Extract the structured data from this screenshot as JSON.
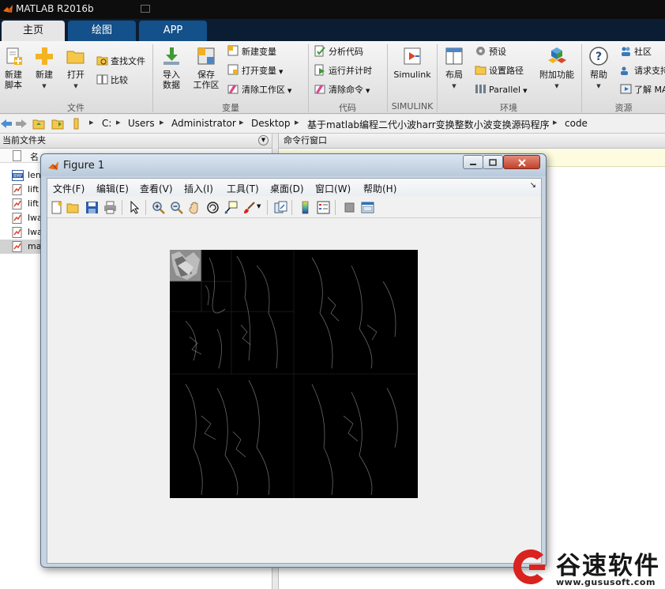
{
  "window": {
    "title": "MATLAB R2016b"
  },
  "ribbon": {
    "tabs": [
      {
        "label": "主页",
        "active": true
      },
      {
        "label": "绘图",
        "active": false
      },
      {
        "label": "APP",
        "active": false
      }
    ],
    "groups": {
      "file": {
        "label": "文件",
        "new_script": "新建\n脚本",
        "new": "新建",
        "open": "打开",
        "find_files": "查找文件",
        "compare": "比较"
      },
      "variable": {
        "label": "变量",
        "import": "导入\n数据",
        "save_ws": "保存\n工作区",
        "new_var": "新建变量",
        "open_var": "打开变量",
        "clear_ws": "清除工作区"
      },
      "code": {
        "label": "代码",
        "analyze": "分析代码",
        "run_time": "运行并计时",
        "clear_cmd": "清除命令"
      },
      "simulink": {
        "label": "SIMULINK",
        "simulink": "Simulink"
      },
      "environment": {
        "label": "环境",
        "layout": "布局",
        "prefs": "预设",
        "set_path": "设置路径",
        "parallel": "Parallel",
        "addons": "附加功能"
      },
      "resources": {
        "label": "资源",
        "help": "帮助",
        "community": "社区",
        "support": "请求支持",
        "learn": "了解 MA"
      }
    }
  },
  "address": {
    "path": [
      "C:",
      "Users",
      "Administrator",
      "Desktop",
      "基于matlab编程二代小波harr变换整数小波变换源码程序",
      "code"
    ]
  },
  "left_pane": {
    "title": "当前文件夹",
    "column": "名",
    "files": [
      {
        "name": "len",
        "type": "bmp"
      },
      {
        "name": "lift",
        "type": "m"
      },
      {
        "name": "lift",
        "type": "m"
      },
      {
        "name": "lwa",
        "type": "m"
      },
      {
        "name": "lwa",
        "type": "m"
      },
      {
        "name": "ma",
        "type": "m",
        "selected": true
      }
    ]
  },
  "command_window": {
    "title": "命令行窗口"
  },
  "figure": {
    "title": "Figure 1",
    "menu": [
      "文件(F)",
      "编辑(E)",
      "查看(V)",
      "插入(I)",
      "工具(T)",
      "桌面(D)",
      "窗口(W)",
      "帮助(H)"
    ],
    "toolbar_icons": [
      "new-figure-icon",
      "open-file-icon",
      "save-icon",
      "print-icon",
      "select-arrow-icon",
      "zoom-in-icon",
      "zoom-out-icon",
      "pan-hand-icon",
      "rotate-3d-icon",
      "data-cursor-icon",
      "brush-icon",
      "link-plot-icon",
      "colorbar-icon",
      "legend-icon",
      "hide-plot-tools-icon",
      "show-plot-tools-icon"
    ]
  },
  "watermark": {
    "brand": "谷速软件",
    "url": "www.gususoft.com"
  },
  "colors": {
    "ribbon_dark": "#0b1d33",
    "ribbon_tab": "#14508a",
    "figure_frame": "#c6d3e1",
    "brand_red": "#d9231f"
  }
}
